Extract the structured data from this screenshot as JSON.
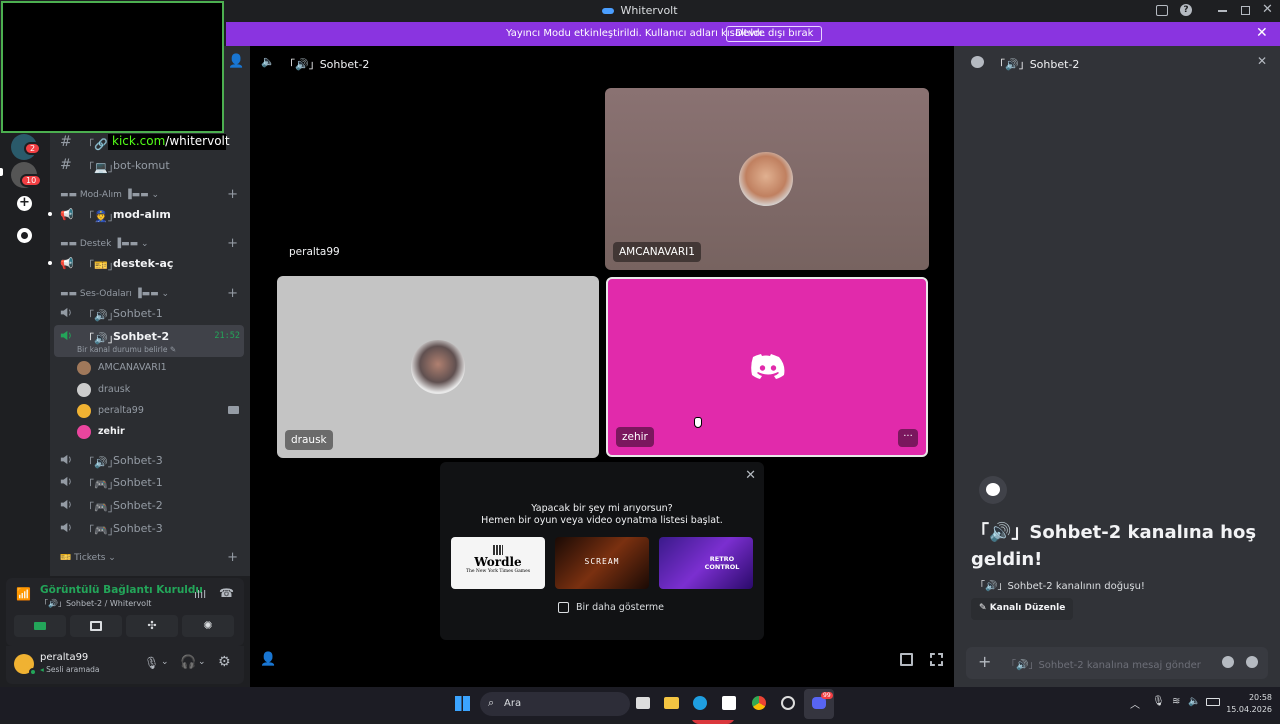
{
  "window": {
    "title": "Whitervolt"
  },
  "banner": {
    "text": "Yayıncı Modu etkinleştirildi. Kullanıcı adları kısaltıldı.",
    "button": "Devre dışı bırak"
  },
  "overlay": {
    "kick_prefix": "kick.com",
    "kick_path": "/whitervolt"
  },
  "rail": {
    "badges": [
      "2",
      "10"
    ]
  },
  "sidebar": {
    "channels_top": [
      {
        "icon": "🔗",
        "label": ""
      },
      {
        "icon": "💻",
        "label": "bot-komut"
      }
    ],
    "categories": [
      {
        "name": "Mod-Alım",
        "prefix": "▬▬ ",
        "suffix": " ▐▬▬"
      },
      {
        "name": "Destek",
        "prefix": "▬▬ ",
        "suffix": " ▐▬▬"
      },
      {
        "name": "Ses-Odaları",
        "prefix": "▬▬ ",
        "suffix": " ▐▬▬"
      },
      {
        "name": "Tickets",
        "prefix": "",
        "suffix": ""
      }
    ],
    "mod_channel": "mod-alım",
    "destek_channel": "destek-aç",
    "voice_channels": [
      "Sohbet-1",
      "Sohbet-2",
      "Sohbet-3",
      "Sohbet-1",
      "Sohbet-2",
      "Sohbet-3"
    ],
    "active_channel": {
      "name": "Sohbet-2",
      "time": "21:52",
      "status": "Bir kanal durumu belirle"
    },
    "members": [
      "AMCANAVARI1",
      "drausk",
      "peralta99",
      "zehir"
    ]
  },
  "voice": {
    "status": "Görüntülü Bağlantı Kuruldu",
    "location": "「🔊」Sohbet-2 / Whitervolt"
  },
  "user": {
    "name": "peralta99",
    "status": "Sesli aramada"
  },
  "stage": {
    "header": "「🔊」Sohbet-2",
    "tiles": [
      {
        "name": "peralta99"
      },
      {
        "name": "AMCANAVARI1"
      },
      {
        "name": "drausk"
      },
      {
        "name": "zehir"
      }
    ]
  },
  "activity": {
    "line1": "Yapacak bir şey mi arıyorsun?",
    "line2": "Hemen bir oyun veya video oynatma listesi başlat.",
    "games": [
      "Wordle",
      "SCREAM",
      "RETRO CONTROL"
    ],
    "wordle_sub": "The New York Times Games",
    "checkbox": "Bir daha gösterme"
  },
  "chat": {
    "header": "「🔊」Sohbet-2",
    "welcome": "「🔊」Sohbet-2 kanalına hoş geldin!",
    "sub": "「🔊」Sohbet-2 kanalının doğuşu!",
    "edit_button": "Kanalı Düzenle",
    "input_placeholder": "「🔊」Sohbet-2 kanalına mesaj gönder"
  },
  "taskbar": {
    "search": "Ara",
    "time": "20:58",
    "date": "15.04.2026",
    "discord_badge": "99"
  }
}
